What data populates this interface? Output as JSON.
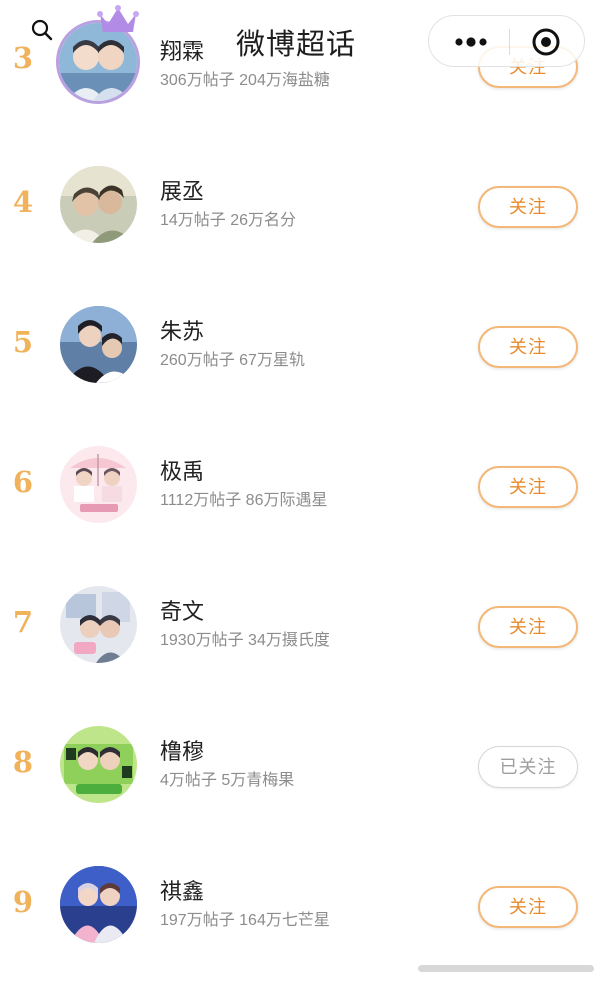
{
  "header": {
    "title": "微博超话",
    "icons": {
      "search": "search-icon",
      "more": "more-icon",
      "close": "close-icon"
    }
  },
  "colors": {
    "rank": "#f0b25a",
    "follow_border": "#f3b877",
    "follow_text": "#e88a2b",
    "followed_text": "#9e9e9e"
  },
  "rows": [
    {
      "rank": "3",
      "name": "翔霖",
      "stats": "306万帖子 204万海盐糖",
      "button": "关注",
      "followed": false
    },
    {
      "rank": "4",
      "name": "展丞",
      "stats": "14万帖子 26万名分",
      "button": "关注",
      "followed": false
    },
    {
      "rank": "5",
      "name": "朱苏",
      "stats": "260万帖子 67万星轨",
      "button": "关注",
      "followed": false
    },
    {
      "rank": "6",
      "name": "极禹",
      "stats": "1112万帖子 86万际遇星",
      "button": "关注",
      "followed": false
    },
    {
      "rank": "7",
      "name": "奇文",
      "stats": "1930万帖子 34万摄氏度",
      "button": "关注",
      "followed": false
    },
    {
      "rank": "8",
      "name": "橹穆",
      "stats": "4万帖子 5万青梅果",
      "button": "已关注",
      "followed": true
    },
    {
      "rank": "9",
      "name": "祺鑫",
      "stats": "197万帖子 164万七芒星",
      "button": "关注",
      "followed": false
    }
  ]
}
